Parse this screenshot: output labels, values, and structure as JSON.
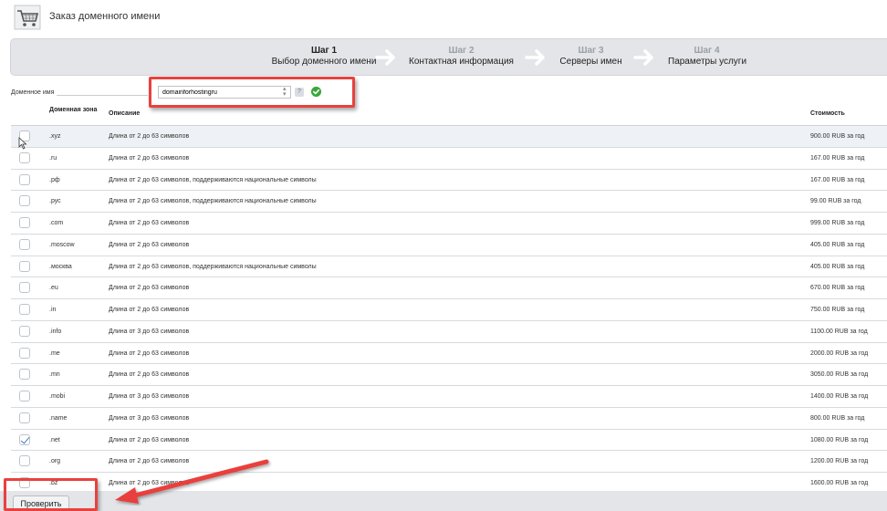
{
  "header": {
    "title": "Заказ доменного имени",
    "icon": "shopping-cart-icon"
  },
  "wizard": {
    "steps": [
      {
        "num": "Шаг 1",
        "label": "Выбор доменного имени",
        "active": true
      },
      {
        "num": "Шаг 2",
        "label": "Контактная информация",
        "active": false
      },
      {
        "num": "Шаг 3",
        "label": "Серверы имен",
        "active": false
      },
      {
        "num": "Шаг 4",
        "label": "Параметры услуги",
        "active": false
      }
    ]
  },
  "domain": {
    "label": "Доменное имя",
    "value": "domainforhostingru",
    "help": "?"
  },
  "table": {
    "headers": {
      "zone": "Доменная зона",
      "desc": "Описание",
      "price": "Стоимость"
    },
    "rows": [
      {
        "zone": ".xyz",
        "desc": "Длина от 2 до 63 символов",
        "price": "900.00 RUB за год",
        "checked": false
      },
      {
        "zone": ".ru",
        "desc": "Длина от 2 до 63 символов",
        "price": "167.00 RUB за год",
        "checked": false
      },
      {
        "zone": ".рф",
        "desc": "Длина от 2 до 63 символов, поддерживаются национальные символы",
        "price": "167.00 RUB за год",
        "checked": false
      },
      {
        "zone": ".рус",
        "desc": "Длина от 2 до 63 символов, поддерживаются национальные символы",
        "price": "99.00 RUB за год",
        "checked": false
      },
      {
        "zone": ".com",
        "desc": "Длина от 2 до 63 символов",
        "price": "999.00 RUB за год",
        "checked": false
      },
      {
        "zone": ".moscow",
        "desc": "Длина от 2 до 63 символов",
        "price": "405.00 RUB за год",
        "checked": false
      },
      {
        "zone": ".москва",
        "desc": "Длина от 2 до 63 символов, поддерживаются национальные символы",
        "price": "405.00 RUB за год",
        "checked": false
      },
      {
        "zone": ".eu",
        "desc": "Длина от 2 до 63 символов",
        "price": "670.00 RUB за год",
        "checked": false
      },
      {
        "zone": ".in",
        "desc": "Длина от 2 до 63 символов",
        "price": "750.00 RUB за год",
        "checked": false
      },
      {
        "zone": ".info",
        "desc": "Длина от 3 до 63 символов",
        "price": "1100.00 RUB за год",
        "checked": false
      },
      {
        "zone": ".me",
        "desc": "Длина от 2 до 63 символов",
        "price": "2000.00 RUB за год",
        "checked": false
      },
      {
        "zone": ".mn",
        "desc": "Длина от 2 до 63 символов",
        "price": "3050.00 RUB за год",
        "checked": false
      },
      {
        "zone": ".mobi",
        "desc": "Длина от 3 до 63 символов",
        "price": "1400.00 RUB за год",
        "checked": false
      },
      {
        "zone": ".name",
        "desc": "Длина от 3 до 63 символов",
        "price": "800.00 RUB за год",
        "checked": false
      },
      {
        "zone": ".net",
        "desc": "Длина от 2 до 63 символов",
        "price": "1080.00 RUB за год",
        "checked": true
      },
      {
        "zone": ".org",
        "desc": "Длина от 2 до 63 символов",
        "price": "1200.00 RUB за год",
        "checked": false
      },
      {
        "zone": ".bz",
        "desc": "Длина от 2 до 63 символов",
        "price": "1600.00 RUB за год",
        "checked": false
      }
    ]
  },
  "footer": {
    "check_label": "Проверить"
  },
  "colors": {
    "annotation_red": "#e8413d",
    "toolbar_bg": "#e3e5e8",
    "ok_green": "#3aa83a",
    "check_blue": "#3a7ec0"
  }
}
